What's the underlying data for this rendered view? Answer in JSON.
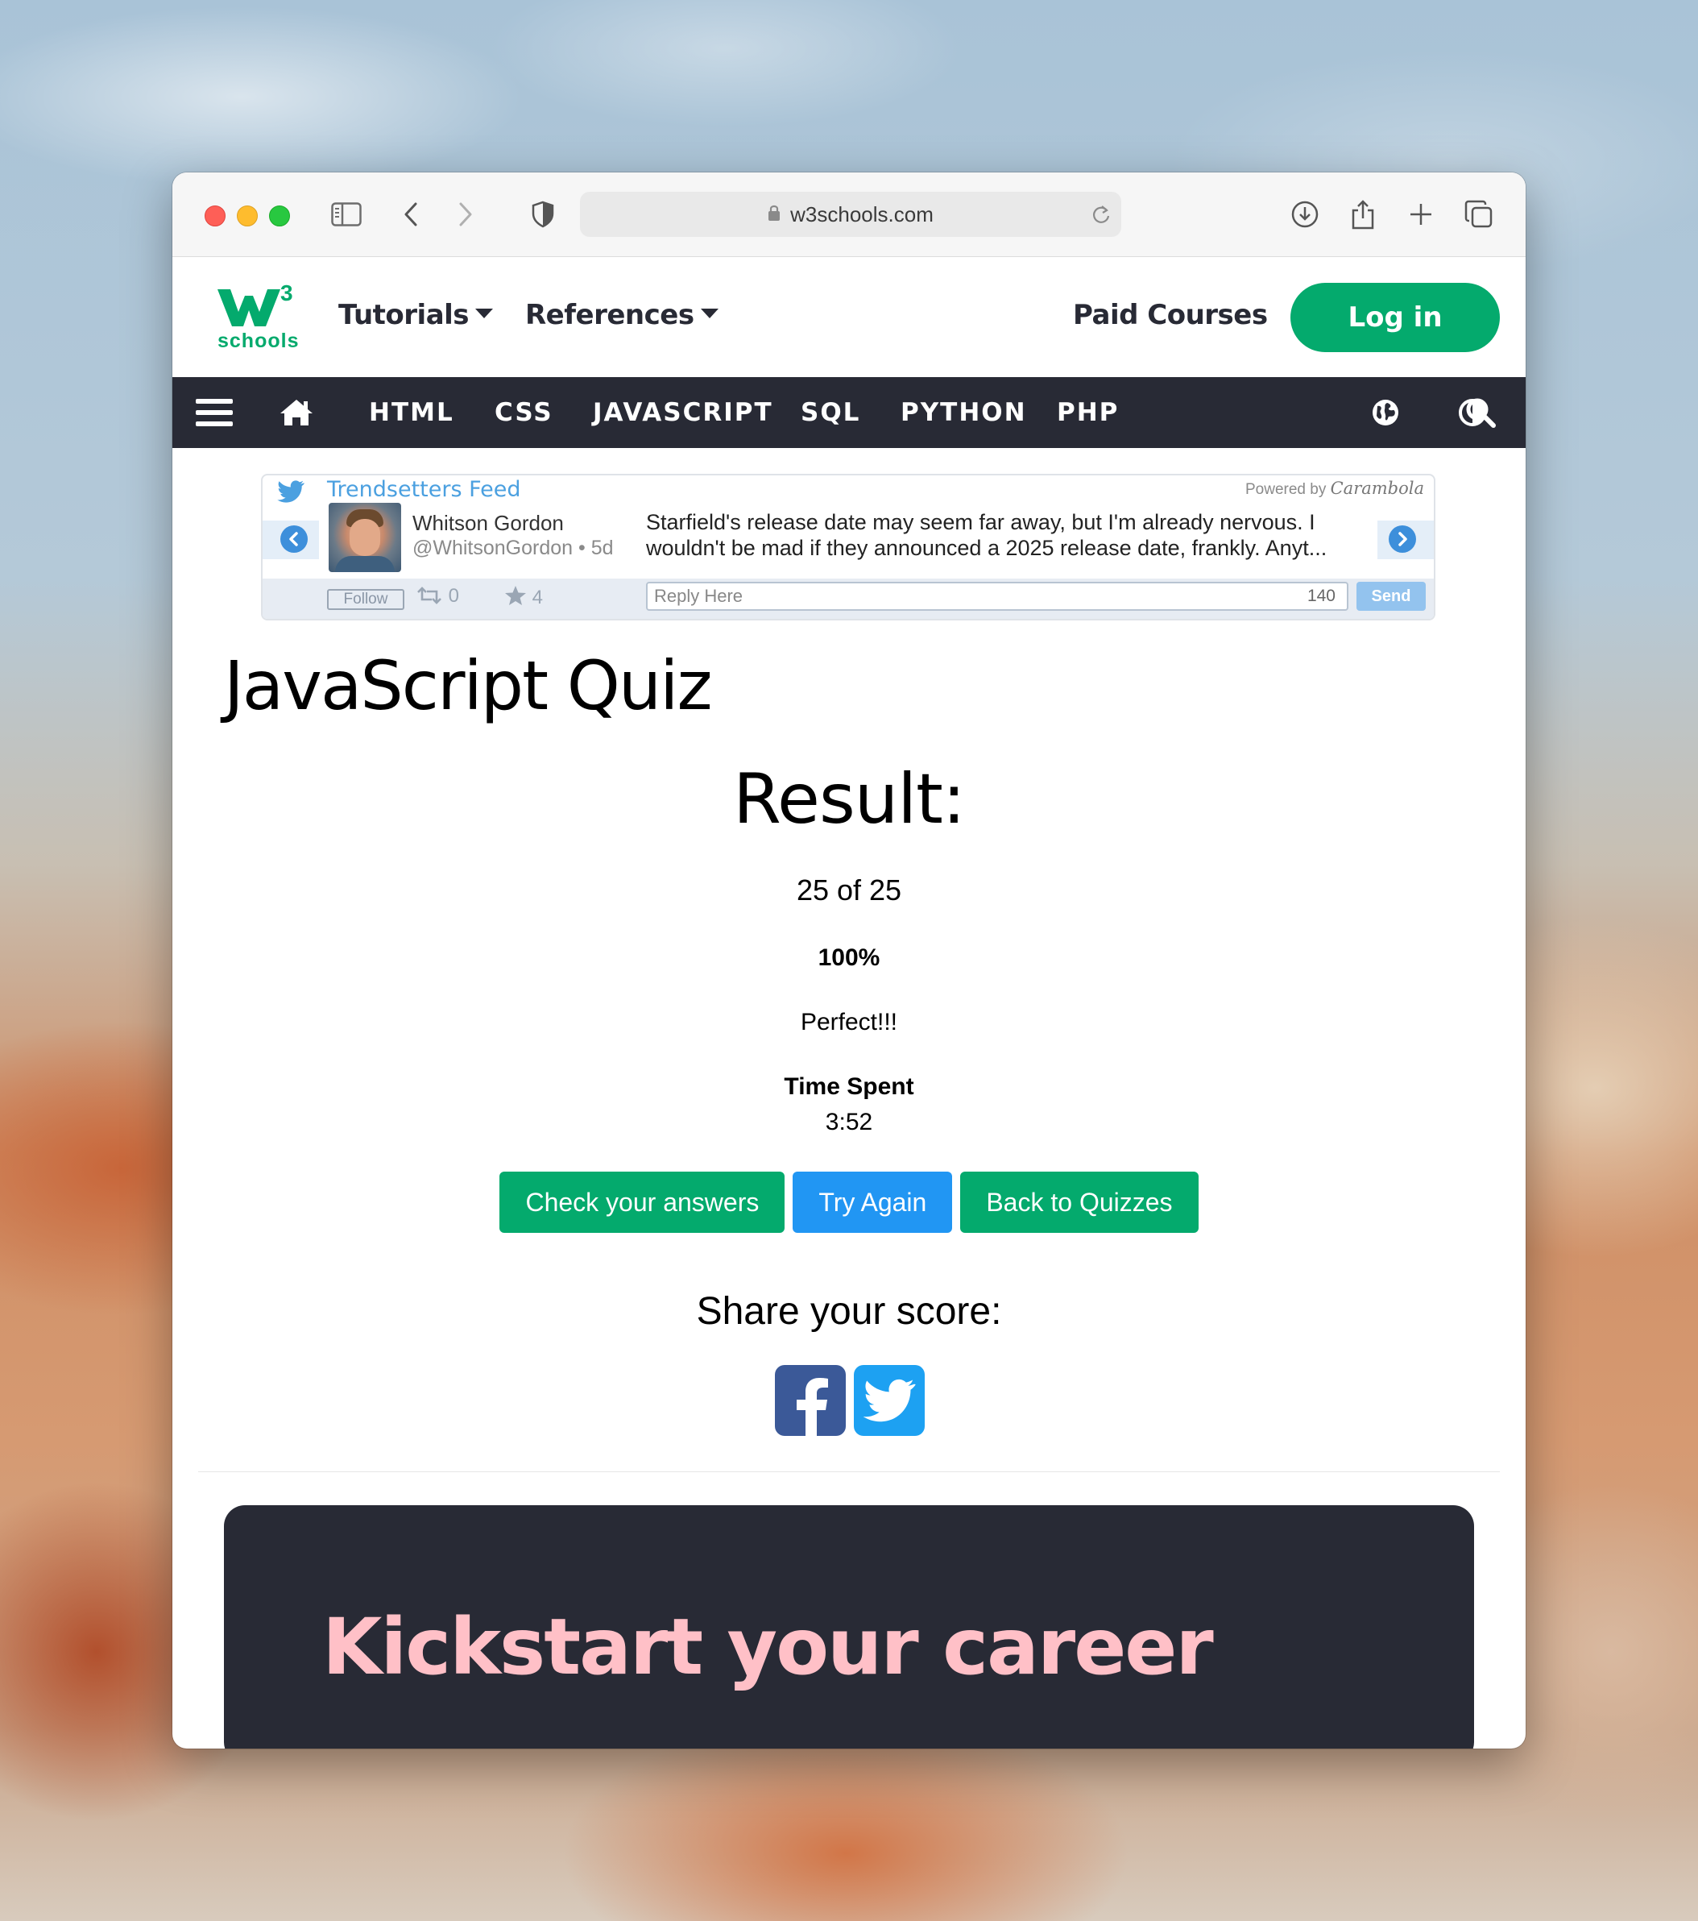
{
  "browser": {
    "url": "w3schools.com"
  },
  "header": {
    "logo_text": "schools",
    "logo_superscript": "3",
    "tutorials": "Tutorials",
    "references": "References",
    "paid_courses": "Paid Courses",
    "login": "Log in"
  },
  "topnav": {
    "items": [
      "HTML",
      "CSS",
      "JAVASCRIPT",
      "SQL",
      "PYTHON",
      "PHP"
    ]
  },
  "feed": {
    "title": "Trendsetters Feed",
    "powered_by": "Powered by",
    "powered_brand": "Carambola",
    "author_name": "Whitson Gordon",
    "author_handle": "@WhitsonGordon • 5d",
    "tweet_line1": "Starfield's release date may seem far away, but I'm already nervous. I",
    "tweet_line2": "wouldn't be mad if they announced a 2025 release date, frankly. Anyt...",
    "follow": "Follow",
    "retweets": "0",
    "favorites": "4",
    "reply_placeholder": "Reply Here",
    "char_count": "140",
    "send": "Send"
  },
  "main": {
    "title": "JavaScript Quiz",
    "result_heading": "Result:",
    "score": "25 of 25",
    "percent": "100%",
    "message": "Perfect!!!",
    "time_label": "Time Spent",
    "time_value": "3:52",
    "buttons": {
      "check": "Check your answers",
      "try_again": "Try Again",
      "back": "Back to Quizzes"
    },
    "share_label": "Share your score:",
    "career_heading": "Kickstart your career"
  },
  "colors": {
    "brand_green": "#04aa6d",
    "nav_dark": "#282a35",
    "button_blue": "#2196f3",
    "career_pink": "#ffc0c7"
  }
}
